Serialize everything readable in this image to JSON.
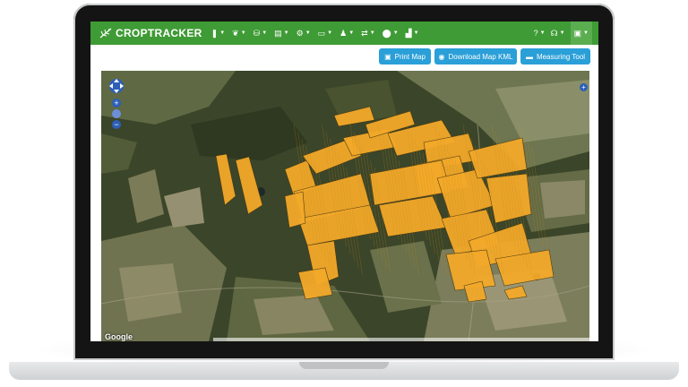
{
  "app": {
    "brand": "CROPTRACKER",
    "brand_color": "#3f9b35"
  },
  "navbar": {
    "items": [
      {
        "icon": "bookmark-icon",
        "glyph": "❚"
      },
      {
        "icon": "leaf-icon",
        "glyph": "❦"
      },
      {
        "icon": "basket-icon",
        "glyph": "⛁"
      },
      {
        "icon": "building-icon",
        "glyph": "▤"
      },
      {
        "icon": "gear-icon",
        "glyph": "⚙"
      },
      {
        "icon": "truck-icon",
        "glyph": "▭"
      },
      {
        "icon": "user-icon",
        "glyph": "♟"
      },
      {
        "icon": "transfer-icon",
        "glyph": "⇄"
      },
      {
        "icon": "pin-icon",
        "glyph": "⬤"
      },
      {
        "icon": "chart-icon",
        "glyph": "▟"
      }
    ],
    "right": [
      {
        "icon": "help-icon",
        "glyph": "?"
      },
      {
        "icon": "headset-icon",
        "glyph": "☊"
      },
      {
        "icon": "account-icon",
        "glyph": "▣"
      }
    ]
  },
  "toolbar": {
    "print_label": "Print Map",
    "kml_label": "Download Map KML",
    "measure_label": "Measuring Tool",
    "button_color": "#2a9fd8"
  },
  "map": {
    "attribution": "Google",
    "field_color": "#f3a92a"
  }
}
